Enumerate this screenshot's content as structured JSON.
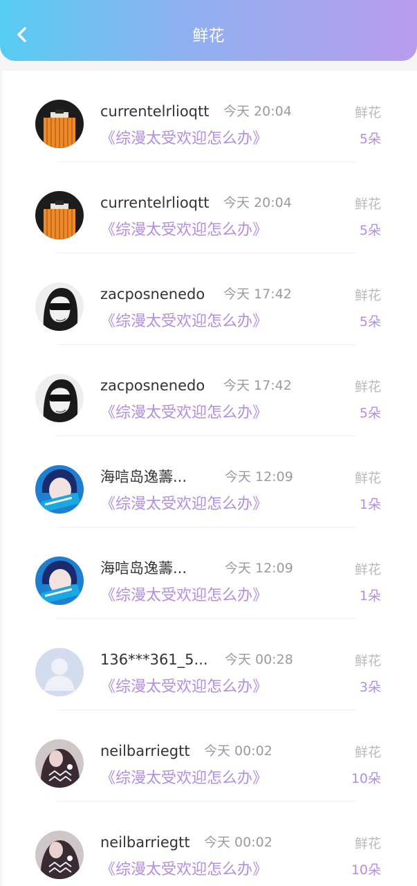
{
  "header": {
    "title": "鲜花",
    "back_icon": "chevron-left-icon",
    "gradient": [
      "#56ccf2",
      "#b99cec"
    ]
  },
  "colors": {
    "accent": "#b48ee0",
    "muted": "#9a9a9a"
  },
  "items": [
    {
      "name": "currentelrlioqtt",
      "time": "今天 20:04",
      "subject": "《综漫太受欢迎怎么办》",
      "type": "鲜花",
      "count": "5朵",
      "avatar": "orange-bag"
    },
    {
      "name": "currentelrlioqtt",
      "time": "今天 20:04",
      "subject": "《综漫太受欢迎怎么办》",
      "type": "鲜花",
      "count": "5朵",
      "avatar": "orange-bag"
    },
    {
      "name": "zacposnenedo",
      "time": "今天 17:42",
      "subject": "《综漫太受欢迎怎么办》",
      "type": "鲜花",
      "count": "5朵",
      "avatar": "sketch-girl"
    },
    {
      "name": "zacposnenedo",
      "time": "今天 17:42",
      "subject": "《综漫太受欢迎怎么办》",
      "type": "鲜花",
      "count": "5朵",
      "avatar": "sketch-girl"
    },
    {
      "name": "海唁岛逸薵...",
      "time": "今天 12:09",
      "subject": "《综漫太受欢迎怎么办》",
      "type": "鲜花",
      "count": "1朵",
      "avatar": "blue-photo"
    },
    {
      "name": "海唁岛逸薵...",
      "time": "今天 12:09",
      "subject": "《综漫太受欢迎怎么办》",
      "type": "鲜花",
      "count": "1朵",
      "avatar": "blue-photo"
    },
    {
      "name": "136***361_5...",
      "time": "今天 00:28",
      "subject": "《综漫太受欢迎怎么办》",
      "type": "鲜花",
      "count": "3朵",
      "avatar": "default-user"
    },
    {
      "name": "neilbarriegtt",
      "time": "今天 00:02",
      "subject": "《综漫太受欢迎怎么办》",
      "type": "鲜花",
      "count": "10朵",
      "avatar": "dark-photo"
    },
    {
      "name": "neilbarriegtt",
      "time": "今天 00:02",
      "subject": "《综漫太受欢迎怎么办》",
      "type": "鲜花",
      "count": "10朵",
      "avatar": "dark-photo"
    }
  ]
}
